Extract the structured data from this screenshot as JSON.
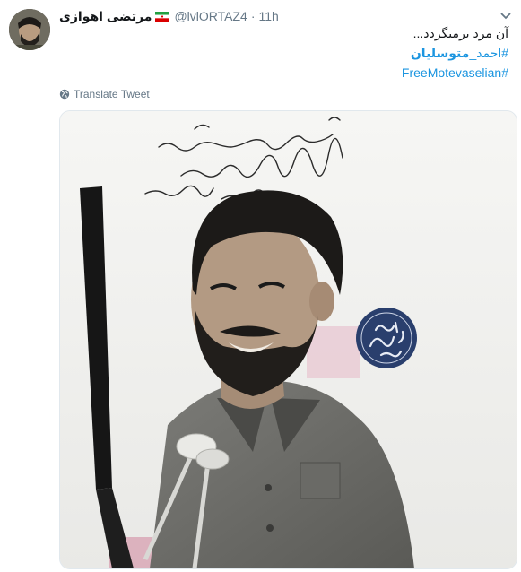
{
  "tweet": {
    "display_name": "مرتضی اهوازی",
    "handle": "@lvlORTAZ4",
    "separator": "·",
    "timestamp": "11h",
    "text_line1": "آن مرد برمیگردد...",
    "hashtag1_prefix": "#احمد_",
    "hashtag1_bold": "متوسلیان",
    "hashtag2": "#FreeMotevaselian",
    "translate_label": "Translate Tweet"
  },
  "icons": {
    "avatar": "profile-avatar",
    "flag": "iran-flag-icon",
    "chevron": "chevron-down-icon",
    "globe": "globe-icon"
  },
  "colors": {
    "link": "#1b95e0",
    "muted": "#657786",
    "text": "#14171a",
    "border": "#e1e8ed"
  }
}
